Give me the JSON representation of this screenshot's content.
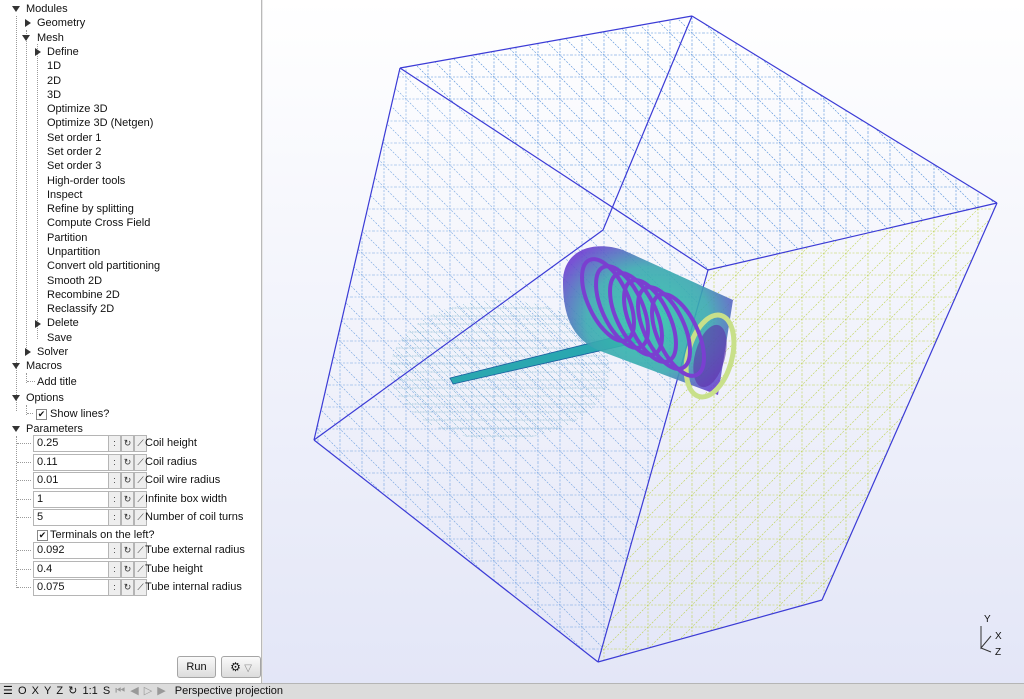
{
  "tree": {
    "modules": "Modules",
    "geometry": "Geometry",
    "mesh": "Mesh",
    "mesh_items": [
      "Define",
      "1D",
      "2D",
      "3D",
      "Optimize 3D",
      "Optimize 3D (Netgen)",
      "Set order 1",
      "Set order 2",
      "Set order 3",
      "High-order tools",
      "Inspect",
      "Refine by splitting",
      "Compute Cross Field",
      "Partition",
      "Unpartition",
      "Convert old partitioning",
      "Smooth 2D",
      "Recombine 2D",
      "Reclassify 2D",
      "Delete",
      "Save"
    ],
    "solver": "Solver",
    "macros": "Macros",
    "add_title": "Add title",
    "options": "Options",
    "show_lines": "Show lines?",
    "parameters": "Parameters"
  },
  "parameters": [
    {
      "value": "0.25",
      "label": "Coil height"
    },
    {
      "value": "0.11",
      "label": "Coil radius"
    },
    {
      "value": "0.01",
      "label": "Coil wire radius"
    },
    {
      "value": "1",
      "label": "Infinite box width"
    },
    {
      "value": "5",
      "label": "Number of coil turns"
    }
  ],
  "terminals_left": "Terminals on the left?",
  "parameters2": [
    {
      "value": "0.092",
      "label": "Tube external radius"
    },
    {
      "value": "0.4",
      "label": "Tube height"
    },
    {
      "value": "0.075",
      "label": "Tube internal radius"
    }
  ],
  "run_label": "Run",
  "status": {
    "buttons": [
      "O",
      "X",
      "Y",
      "Z"
    ],
    "scale": "1:1",
    "s": "S",
    "projection": "Perspective projection"
  },
  "axes": {
    "y": "Y",
    "x": "X",
    "z": "Z"
  },
  "colors": {
    "box_edge": "#3b3bd6",
    "mesh_blue": "#3a7fd5",
    "mesh_yellow": "#b8cf3c",
    "coil": "#7a3fd0"
  }
}
